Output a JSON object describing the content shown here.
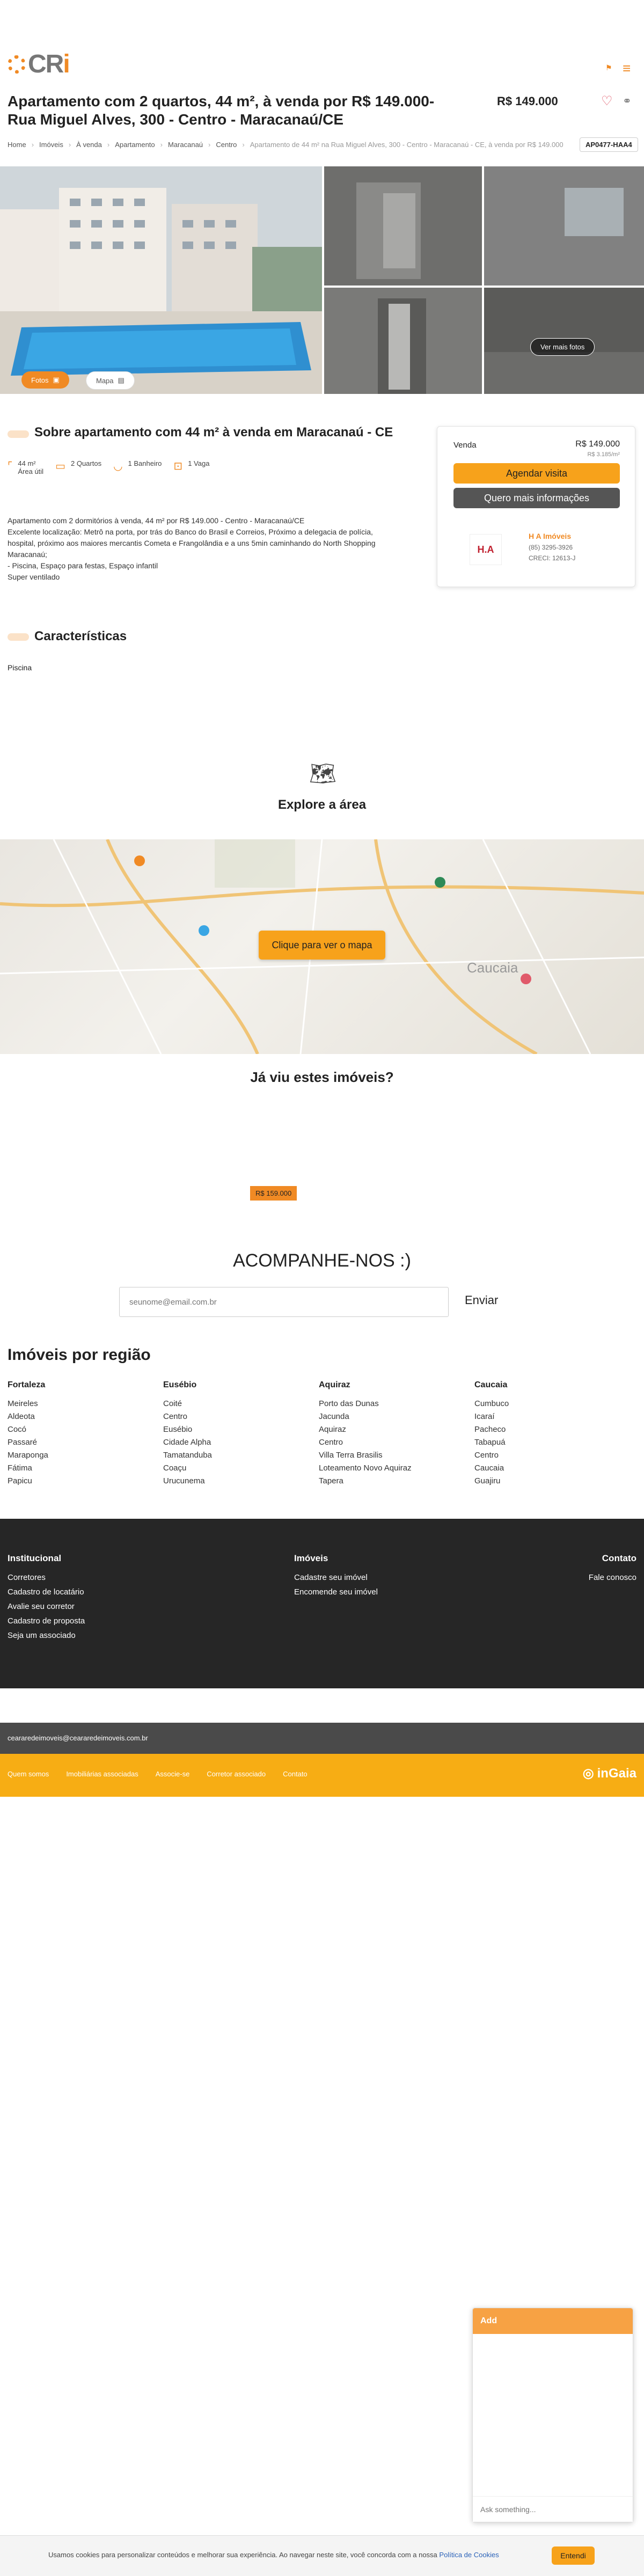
{
  "brand": {
    "logo": "CRi",
    "accent": "#f08a24",
    "accent2": "#f7a21b"
  },
  "header": {
    "title_line1": "Apartamento com 2 quartos, 44 m², à venda por R$ 149.000-",
    "title_line2": "Rua Miguel Alves, 300 - Centro - Maracanaú/CE",
    "price": "R$ 149.000",
    "code": "AP0477-HAA4",
    "icons": [
      "heart-icon",
      "share-icon"
    ]
  },
  "breadcrumb": [
    "Home",
    "Imóveis",
    "À venda",
    "Apartamento",
    "Maracanaú",
    "Centro",
    "Apartamento de 44 m² na Rua Miguel Alves, 300 - Centro - Maracanaú - CE, à venda por R$ 149.000"
  ],
  "gallery": {
    "photos_label": "Fotos",
    "map_label": "Mapa",
    "more_label": "Ver mais fotos"
  },
  "about": {
    "heading": "Sobre apartamento com 44 m² à venda em Maracanaú - CE",
    "features": [
      {
        "value": "44 m²",
        "label": "Área útil",
        "icon": "area-icon"
      },
      {
        "value": "2 Quartos",
        "label": "",
        "icon": "bed-icon"
      },
      {
        "value": "1 Banheiro",
        "label": "",
        "icon": "bath-icon"
      },
      {
        "value": "1 Vaga",
        "label": "",
        "icon": "car-icon"
      }
    ],
    "desc": [
      "Apartamento com 2 dormitórios à venda, 44 m² por R$ 149.000 - Centro - Maracanaú/CE",
      "Excelente localização: Metrô na porta, por trás do Banco do Brasil e Correios, Próximo a delegacia de polícia, hospital, próximo aos maiores mercantis Cometa e Frangolândia e a uns 5min caminhando do North Shopping Maracanaú;",
      "- Piscina, Espaço para festas, Espaço infantil",
      "Super ventilado"
    ]
  },
  "sidebar": {
    "sale_label": "Venda",
    "sale_price": "R$ 149.000",
    "condo": "R$ 3.185/m²",
    "schedule_btn": "Agendar visita",
    "info_btn": "Quero mais informações",
    "agent_name": "H A Imóveis",
    "agent_phone": "(85) 3295-3926",
    "agent_creci": "CRECI: 12613-J",
    "agent_logo": "H.A"
  },
  "characteristics": {
    "heading": "Características",
    "items": [
      "Piscina"
    ]
  },
  "explore": {
    "heading": "Explore a área",
    "map_btn": "Clique para ver o mapa",
    "map_city": "Caucaia"
  },
  "seen": {
    "heading": "Já viu estes imóveis?",
    "badge": "R$ 159.000"
  },
  "follow": {
    "heading": "ACOMPANHE-NOS :)",
    "placeholder": "seunome@email.com.br",
    "send": "Enviar"
  },
  "regions": {
    "heading": "Imóveis por região",
    "cols": [
      {
        "title": "Fortaleza",
        "items": [
          "Meireles",
          "Aldeota",
          "Cocó",
          "Passaré",
          "Maraponga",
          "Fátima",
          "Papicu"
        ]
      },
      {
        "title": "Eusébio",
        "items": [
          "Coité",
          "Centro",
          "Eusébio",
          "Cidade Alpha",
          "Tamatanduba",
          "Coaçu",
          "Urucunema"
        ]
      },
      {
        "title": "Aquiraz",
        "items": [
          "Porto das Dunas",
          "Jacunda",
          "Aquiraz",
          "Centro",
          "Villa Terra Brasilis",
          "Loteamento Novo Aquiraz",
          "Tapera"
        ]
      },
      {
        "title": "Caucaia",
        "items": [
          "Cumbuco",
          "Icaraí",
          "Pacheco",
          "Tabapuá",
          "Centro",
          "Caucaia",
          "Guajiru"
        ]
      }
    ]
  },
  "footer": {
    "inst_title": "Institucional",
    "inst_items": [
      "Corretores",
      "Cadastro de locatário",
      "Avalie seu corretor",
      "Cadastro de proposta",
      "Seja um associado"
    ],
    "imv_title": "Imóveis",
    "imv_items": [
      "Cadastre seu imóvel",
      "Encomende seu imóvel"
    ],
    "contact_title": "Contato",
    "contact_items": [
      "Fale conosco"
    ],
    "email": "ceararedeimoveis@ceararedeimoveis.com.br",
    "links": [
      "Quem somos",
      "Imobiliárias associadas",
      "Associe-se",
      "Corretor associado",
      "Contato"
    ],
    "ingaia": "inGaia"
  },
  "chat": {
    "title": "Add",
    "placeholder": "Ask something..."
  },
  "cookie": {
    "text": "Usamos cookies para personalizar conteúdos e melhorar sua experiência. Ao navegar neste site, você concorda com a nossa",
    "link": "Política de Cookies",
    "btn": "Entendi"
  }
}
